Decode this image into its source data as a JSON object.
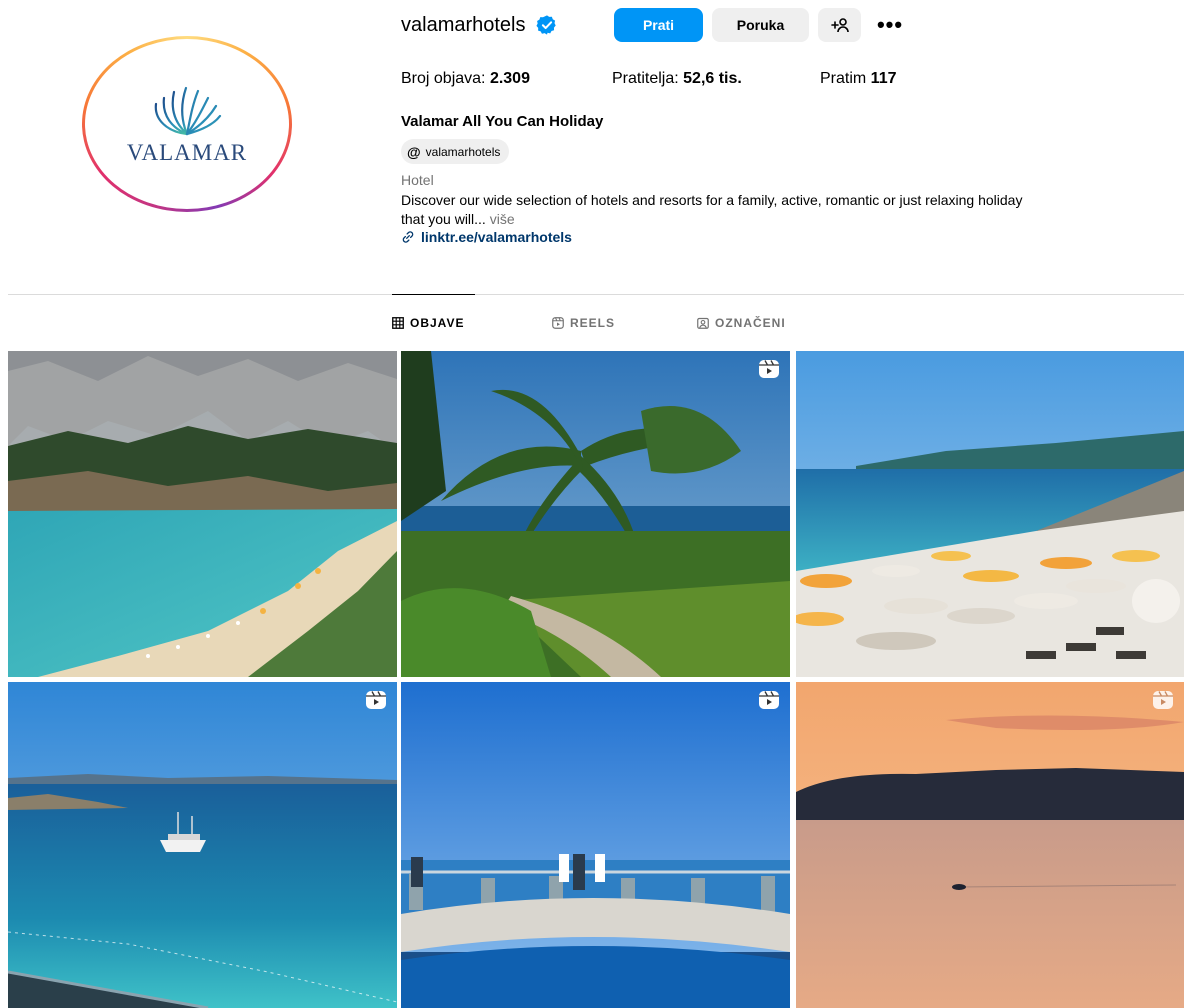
{
  "profile": {
    "username": "valamarhotels",
    "logo_text": "VALAMAR",
    "buttons": {
      "follow": "Prati",
      "message": "Poruka",
      "suggest": "+S",
      "more": "•••"
    },
    "stats": {
      "posts_label": "Broj objava: ",
      "posts_value": "2.309",
      "followers_label": "Pratitelja: ",
      "followers_value": "52,6 tis.",
      "following_label": "Pratim ",
      "following_value": "117"
    },
    "full_name": "Valamar All You Can Holiday",
    "threads_handle": "valamarhotels",
    "category": "Hotel",
    "bio_line1": "Discover our wide selection of hotels and resorts for a family, active, romantic or just relaxing holiday",
    "bio_line2": "that you will... ",
    "bio_more": "više",
    "link": "linktr.ee/valamarhotels"
  },
  "tabs": [
    {
      "label": "OBJAVE",
      "active": true,
      "icon": "grid-icon"
    },
    {
      "label": "REELS",
      "active": false,
      "icon": "reels-icon"
    },
    {
      "label": "OZNAČENI",
      "active": false,
      "icon": "tagged-icon"
    }
  ],
  "posts": [
    {
      "scene": "mountain-bay-beach",
      "reel": false
    },
    {
      "scene": "palm-garden-sea",
      "reel": true
    },
    {
      "scene": "pebble-beach-umbrellas",
      "reel": false
    },
    {
      "scene": "boat-turquoise-sea",
      "reel": true
    },
    {
      "scene": "cliff-viewpoint",
      "reel": true
    },
    {
      "scene": "sunset-sea-jetski",
      "reel": true
    }
  ],
  "colors": {
    "follow_button": "#0095f6",
    "secondary_button": "#efefef",
    "link": "#00376b",
    "muted_text": "#737373",
    "verified": "#0095f6"
  }
}
